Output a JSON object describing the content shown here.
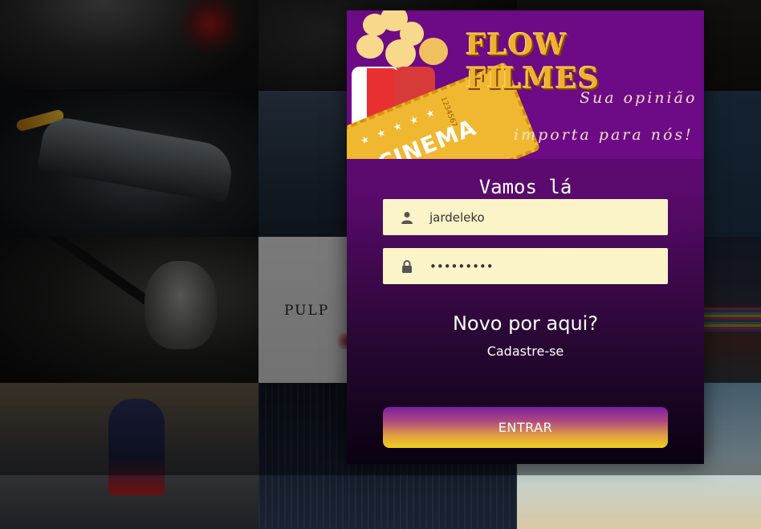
{
  "background": {
    "posters": [
      "poster-1",
      "poster-2",
      "poster-3",
      "poster-4",
      "poster-5",
      "poster-6",
      "poster-7",
      "poster-8",
      "poster-9",
      "poster-10",
      "poster-11",
      "poster-12"
    ],
    "pulp_text": "PULP"
  },
  "banner": {
    "brand_title": "FLOW FILMES",
    "tagline_line1": "Sua opinião",
    "tagline_line2": "importa para nós!",
    "ticket_text": "CINEMA",
    "ticket_number": "1234567"
  },
  "login": {
    "heading": "Vamos lá",
    "username": {
      "value": "jardeleko",
      "icon": "user-icon"
    },
    "password": {
      "value": "•••••••••",
      "icon": "lock-icon"
    },
    "new_here": "Novo por aqui?",
    "signup_link": "Cadastre-se",
    "submit_label": "ENTRAR"
  },
  "colors": {
    "card_top": "#6a0a80",
    "field_bg": "#fbf4c8",
    "brand_gold": "#f0b030",
    "button_gradient_end": "#f0d020"
  }
}
